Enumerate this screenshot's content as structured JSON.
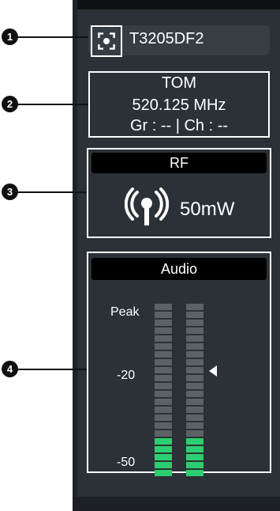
{
  "callouts": [
    "1",
    "2",
    "3",
    "4"
  ],
  "channel": {
    "name": "T3205DF2",
    "id_icon": "identify-icon"
  },
  "frequency": {
    "label": "TOM",
    "freq": "520.125 MHz",
    "group_channel": "Gr : -- | Ch : --"
  },
  "rf": {
    "title": "RF",
    "icon": "antenna-icon",
    "power": "50mW"
  },
  "audio": {
    "title": "Audio",
    "scale": {
      "peak": "Peak",
      "mid": "-20",
      "low": "-50"
    },
    "meters": [
      {
        "segments_total": 22,
        "segments_lit": 5
      },
      {
        "segments_total": 22,
        "segments_lit": 5
      }
    ],
    "level_marker": "-20"
  },
  "colors": {
    "panel": "#2b3136",
    "meter_on": "#2ccf6f",
    "meter_off": "#5c6166"
  }
}
